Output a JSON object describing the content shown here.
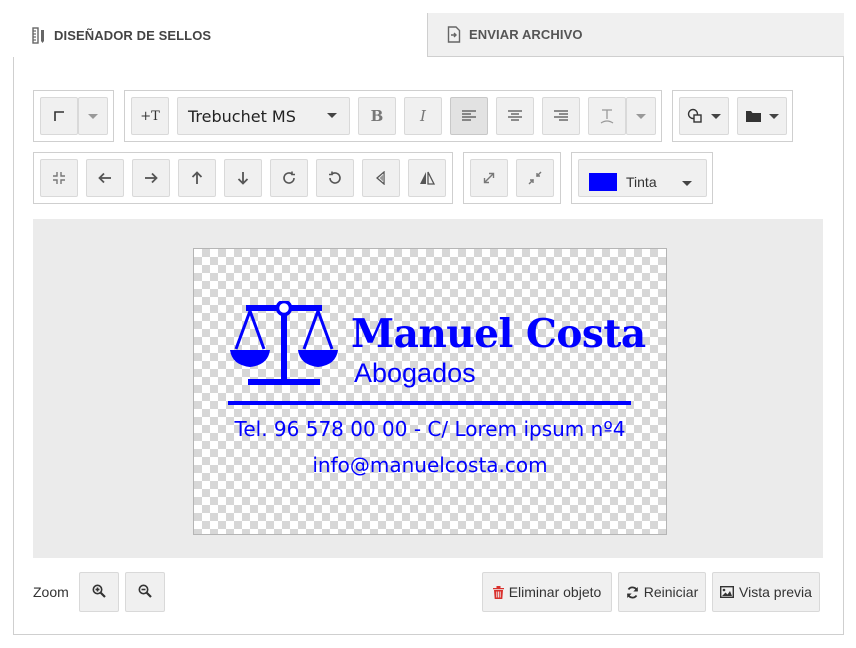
{
  "tabs": {
    "designer": {
      "label": "DISEÑADOR DE SELLOS",
      "icon": "ruler-pencil-icon",
      "active": true
    },
    "send": {
      "label": "ENVIAR ARCHIVO",
      "icon": "file-arrow-icon",
      "active": false
    }
  },
  "toolbar": {
    "row1": {
      "corner_tool": {
        "icon": "corner-icon",
        "dropdown": true
      },
      "add_text": {
        "label": "+T",
        "icon": "add-text-icon"
      },
      "font_family": {
        "value": "Trebuchet MS"
      },
      "bold": {
        "label": "B"
      },
      "italic": {
        "label": "I"
      },
      "align_left": {
        "icon": "align-left-icon",
        "pressed": true
      },
      "align_center": {
        "icon": "align-center-icon"
      },
      "align_right": {
        "icon": "align-right-icon"
      },
      "text_curve": {
        "icon": "text-baseline-icon",
        "dropdown": true
      },
      "shapes": {
        "icon": "shapes-icon",
        "dropdown": true
      },
      "folder": {
        "icon": "folder-icon",
        "dropdown": true
      }
    },
    "row2": {
      "center": {
        "icon": "compress-icon"
      },
      "move_left": {
        "icon": "arrow-left-icon"
      },
      "move_right": {
        "icon": "arrow-right-icon"
      },
      "move_up": {
        "icon": "arrow-up-icon"
      },
      "move_down": {
        "icon": "arrow-down-icon"
      },
      "rotate_cw": {
        "icon": "rotate-cw-icon"
      },
      "rotate_ccw": {
        "icon": "rotate-ccw-icon"
      },
      "flip_horizontal": {
        "icon": "flip-horizontal-icon"
      },
      "flip_vertical": {
        "icon": "flip-vertical-icon"
      },
      "enlarge": {
        "icon": "expand-icon"
      },
      "shrink": {
        "icon": "shrink-icon"
      },
      "ink_color": {
        "label": "Tinta",
        "color": "#0000ff"
      }
    }
  },
  "stamp": {
    "name": "Manuel Costa",
    "subtitle": "Abogados",
    "phone_line": "Tel. 96 578 00 00 - C/ Lorem ipsum nº4",
    "email": "info@manuelcosta.com",
    "ink": "#0000ff",
    "logo": "scales-of-justice-icon"
  },
  "footer": {
    "zoom_label": "Zoom",
    "zoom_in": {
      "icon": "zoom-in-icon"
    },
    "zoom_out": {
      "icon": "zoom-out-icon"
    },
    "delete_object": {
      "label": "Eliminar objeto",
      "icon": "trash-icon",
      "icon_color": "#d9302c"
    },
    "reset": {
      "label": "Reiniciar",
      "icon": "refresh-icon"
    },
    "preview": {
      "label": "Vista previa",
      "icon": "image-icon"
    }
  }
}
